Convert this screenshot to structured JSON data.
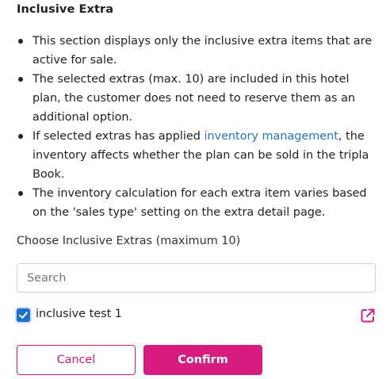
{
  "section": {
    "title": "Inclusive Extra"
  },
  "bullets": [
    {
      "text": "This section displays only the inclusive extra items that are active for sale."
    },
    {
      "text": "The selected extras (max. 10) are included in this hotel plan, the customer does not need to reserve them as an additional option."
    },
    {
      "before": "If selected extras has applied ",
      "link": "inventory management",
      "after": ", the inventory affects whether the plan can be sold in the tripla Book."
    },
    {
      "text": "The inventory calculation for each extra item varies based on the 'sales type' setting on the extra detail page."
    }
  ],
  "chooser": {
    "label": "Choose Inclusive Extras (maximum 10)",
    "search_placeholder": "Search",
    "search_value": ""
  },
  "items": [
    {
      "label": "inclusive test 1",
      "checked": true,
      "action_icon": "external-link-icon"
    }
  ],
  "buttons": {
    "cancel": "Cancel",
    "confirm": "Confirm"
  },
  "colors": {
    "accent": "#d81b7f",
    "link": "#1f75cb",
    "checkbox": "#1a6fd0"
  }
}
